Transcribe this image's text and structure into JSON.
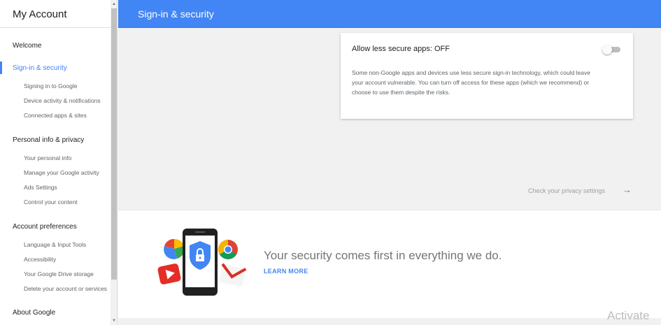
{
  "sidebar": {
    "title": "My Account",
    "sections": [
      {
        "label": "Welcome",
        "active": false
      },
      {
        "label": "Sign-in & security",
        "active": true
      },
      {
        "label": "Personal info & privacy",
        "active": false
      },
      {
        "label": "Account preferences",
        "active": false
      },
      {
        "label": "About Google",
        "active": false
      }
    ],
    "signin_items": [
      "Signing in to Google",
      "Device activity & notifications",
      "Connected apps & sites"
    ],
    "privacy_items": [
      "Your personal info",
      "Manage your Google activity",
      "Ads Settings",
      "Control your content"
    ],
    "prefs_items": [
      "Language & Input Tools",
      "Accessibility",
      "Your Google Drive storage",
      "Delete your account or services"
    ]
  },
  "header": {
    "title": "Sign-in & security"
  },
  "card": {
    "title": "Allow less secure apps: OFF",
    "toggle_on": false,
    "description": "Some non-Google apps and devices use less secure sign-in technology, which could leave your account vulnerable. You can turn off access for these apps (which we recommend) or choose to use them despite the risks."
  },
  "privacy_link": {
    "label": "Check your privacy settings",
    "icon": "arrow-right-icon"
  },
  "banner": {
    "title": "Your security comes first in everything we do.",
    "link": "LEARN MORE"
  },
  "watermark": "Activate",
  "colors": {
    "accent": "#4285f4",
    "header_bg": "#4285f4"
  }
}
